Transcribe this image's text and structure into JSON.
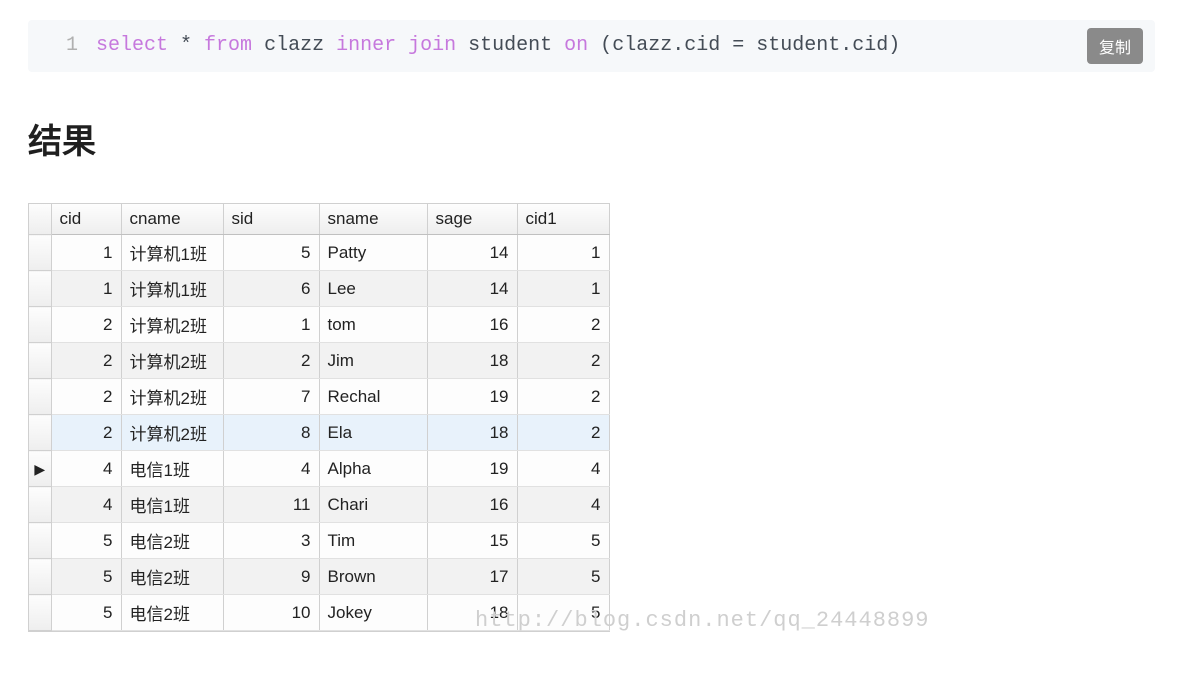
{
  "code": {
    "lineNumber": "1",
    "tokens": {
      "select": "select",
      "star": " * ",
      "from": "from",
      "sp": " ",
      "clazz": "clazz ",
      "inner": "inner",
      "join": "join",
      "student": " student ",
      "on": "on",
      "open": " (",
      "lhs": "clazz.cid",
      "eq": " = ",
      "rhs": "student.cid",
      "close": ")"
    },
    "copyLabel": "复制"
  },
  "resultHeading": "结果",
  "table": {
    "columns": [
      "cid",
      "cname",
      "sid",
      "sname",
      "sage",
      "cid1"
    ],
    "rows": [
      {
        "cid": 1,
        "cname": "计算机1班",
        "sid": 5,
        "sname": "Patty",
        "sage": 14,
        "cid1": 1,
        "hl": false,
        "active": false
      },
      {
        "cid": 1,
        "cname": "计算机1班",
        "sid": 6,
        "sname": "Lee",
        "sage": 14,
        "cid1": 1,
        "hl": false,
        "active": false
      },
      {
        "cid": 2,
        "cname": "计算机2班",
        "sid": 1,
        "sname": "tom",
        "sage": 16,
        "cid1": 2,
        "hl": false,
        "active": false
      },
      {
        "cid": 2,
        "cname": "计算机2班",
        "sid": 2,
        "sname": "Jim",
        "sage": 18,
        "cid1": 2,
        "hl": false,
        "active": false
      },
      {
        "cid": 2,
        "cname": "计算机2班",
        "sid": 7,
        "sname": "Rechal",
        "sage": 19,
        "cid1": 2,
        "hl": false,
        "active": false
      },
      {
        "cid": 2,
        "cname": "计算机2班",
        "sid": 8,
        "sname": "Ela",
        "sage": 18,
        "cid1": 2,
        "hl": true,
        "active": false
      },
      {
        "cid": 4,
        "cname": "电信1班",
        "sid": 4,
        "sname": "Alpha",
        "sage": 19,
        "cid1": 4,
        "hl": false,
        "active": true
      },
      {
        "cid": 4,
        "cname": "电信1班",
        "sid": 11,
        "sname": "Chari",
        "sage": 16,
        "cid1": 4,
        "hl": false,
        "active": false
      },
      {
        "cid": 5,
        "cname": "电信2班",
        "sid": 3,
        "sname": "Tim",
        "sage": 15,
        "cid1": 5,
        "hl": false,
        "active": false
      },
      {
        "cid": 5,
        "cname": "电信2班",
        "sid": 9,
        "sname": "Brown",
        "sage": 17,
        "cid1": 5,
        "hl": false,
        "active": false
      },
      {
        "cid": 5,
        "cname": "电信2班",
        "sid": 10,
        "sname": "Jokey",
        "sage": 18,
        "cid1": 5,
        "hl": false,
        "active": false
      }
    ]
  },
  "watermark": "http://blog.csdn.net/qq_24448899"
}
